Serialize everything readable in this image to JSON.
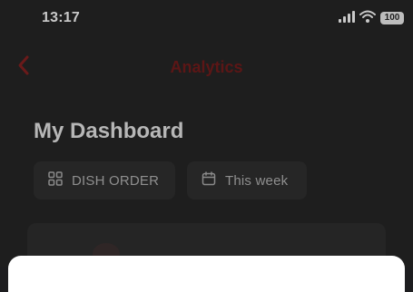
{
  "status_bar": {
    "time": "13:17",
    "battery_level": "100",
    "icons": [
      "signal-icon",
      "wifi-icon",
      "battery-icon"
    ]
  },
  "nav": {
    "back_icon": "chevron-left-icon",
    "title": "Analytics"
  },
  "page": {
    "title": "My Dashboard"
  },
  "filters": [
    {
      "icon": "grid-icon",
      "label": "DISH ORDER"
    },
    {
      "icon": "calendar-icon",
      "label": "This week"
    }
  ],
  "colors": {
    "accent": "#7a1c1c",
    "background": "#1e1e1e",
    "chip_background": "#262626",
    "sheet": "#ffffff"
  }
}
